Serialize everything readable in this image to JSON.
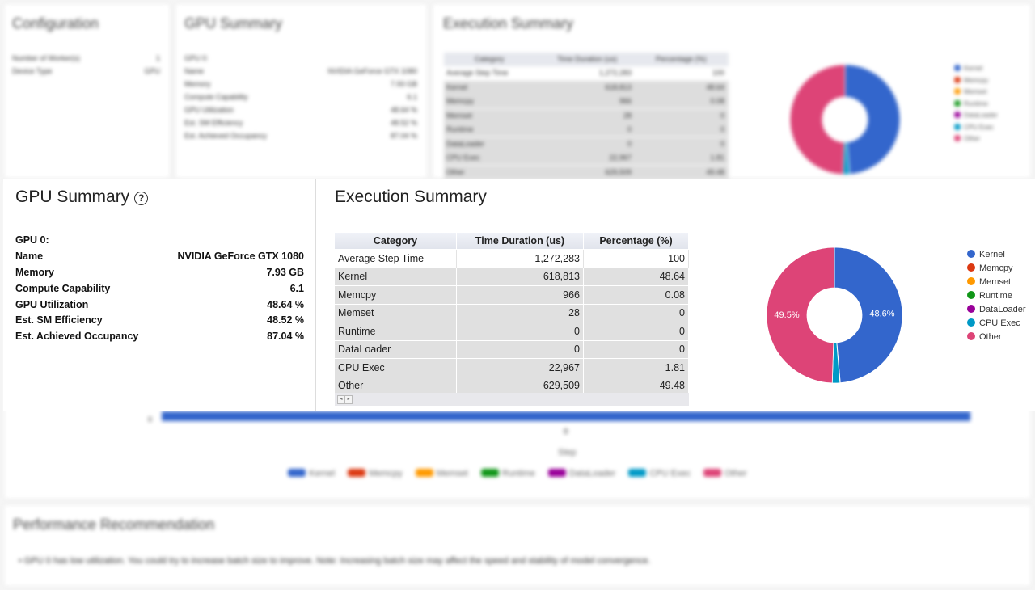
{
  "colors": {
    "kernel": "#3366cc",
    "memcpy": "#dc3912",
    "memset": "#ff9900",
    "runtime": "#109618",
    "dataloader": "#990099",
    "cpu_exec": "#0099c6",
    "other": "#dd4477"
  },
  "background": {
    "config": {
      "title": "Configuration",
      "rows": [
        {
          "label": "Number of Worker(s)",
          "value": "1"
        },
        {
          "label": "Device Type",
          "value": "GPU"
        }
      ]
    },
    "gpu": {
      "title": "GPU Summary",
      "rows": [
        {
          "label": "GPU 0:",
          "value": ""
        },
        {
          "label": "Name",
          "value": "NVIDIA GeForce GTX 1080"
        },
        {
          "label": "Memory",
          "value": "7.93 GB"
        },
        {
          "label": "Compute Capability",
          "value": "6.1"
        },
        {
          "label": "GPU Utilization",
          "value": "48.64 %"
        },
        {
          "label": "Est. SM Efficiency",
          "value": "48.52 %"
        },
        {
          "label": "Est. Achieved Occupancy",
          "value": "87.04 %"
        }
      ]
    },
    "exec": {
      "title": "Execution Summary",
      "headers": [
        "Category",
        "Time Duration (us)",
        "Percentage (%)"
      ],
      "rows": [
        [
          "Average Step Time",
          "1,272,283",
          "100"
        ],
        [
          "Kernel",
          "618,813",
          "48.64"
        ],
        [
          "Memcpy",
          "966",
          "0.08"
        ],
        [
          "Memset",
          "28",
          "0"
        ],
        [
          "Runtime",
          "0",
          "0"
        ],
        [
          "DataLoader",
          "0",
          "0"
        ],
        [
          "CPU Exec",
          "22,967",
          "1.81"
        ],
        [
          "Other",
          "629,509",
          "49.48"
        ]
      ]
    },
    "step_chart": {
      "axis_zero": "0",
      "x_tick": "0",
      "x_label": "Step"
    },
    "recommendation": {
      "title": "Performance Recommendation",
      "text": "• GPU 0 has low utilization. You could try to increase batch size to improve. Note: Increasing batch size may affect the speed and stability of model convergence."
    }
  },
  "gpu_summary": {
    "title": "GPU Summary",
    "help_icon": "question-circle-icon",
    "help_glyph": "?",
    "gpu_heading": "GPU 0:",
    "rows": [
      {
        "label": "Name",
        "value": "NVIDIA GeForce GTX 1080"
      },
      {
        "label": "Memory",
        "value": "7.93 GB"
      },
      {
        "label": "Compute Capability",
        "value": "6.1"
      },
      {
        "label": "GPU Utilization",
        "value": "48.64 %"
      },
      {
        "label": "Est. SM Efficiency",
        "value": "48.52 %"
      },
      {
        "label": "Est. Achieved Occupancy",
        "value": "87.04 %"
      }
    ]
  },
  "execution_summary": {
    "title": "Execution Summary",
    "table": {
      "headers": [
        "Category",
        "Time Duration (us)",
        "Percentage (%)"
      ],
      "rows": [
        {
          "category": "Average Step Time",
          "duration": "1,272,283",
          "percentage": "100"
        },
        {
          "category": "Kernel",
          "duration": "618,813",
          "percentage": "48.64"
        },
        {
          "category": "Memcpy",
          "duration": "966",
          "percentage": "0.08"
        },
        {
          "category": "Memset",
          "duration": "28",
          "percentage": "0"
        },
        {
          "category": "Runtime",
          "duration": "0",
          "percentage": "0"
        },
        {
          "category": "DataLoader",
          "duration": "0",
          "percentage": "0"
        },
        {
          "category": "CPU Exec",
          "duration": "22,967",
          "percentage": "1.81"
        },
        {
          "category": "Other",
          "duration": "629,509",
          "percentage": "49.48"
        }
      ]
    },
    "scroll_left_glyph": "◂",
    "scroll_right_glyph": "▸",
    "legend": [
      "Kernel",
      "Memcpy",
      "Memset",
      "Runtime",
      "DataLoader",
      "CPU Exec",
      "Other"
    ]
  },
  "chart_data": {
    "type": "pie",
    "donut": true,
    "labels": [
      "Kernel",
      "Memcpy",
      "Memset",
      "Runtime",
      "DataLoader",
      "CPU Exec",
      "Other"
    ],
    "values": [
      48.64,
      0.08,
      0,
      0,
      0,
      1.81,
      49.48
    ],
    "colors": [
      "#3366cc",
      "#dc3912",
      "#ff9900",
      "#109618",
      "#990099",
      "#0099c6",
      "#dd4477"
    ],
    "slice_labels": {
      "Kernel": "48.6%",
      "Other": "49.5%"
    },
    "legend_position": "right"
  }
}
